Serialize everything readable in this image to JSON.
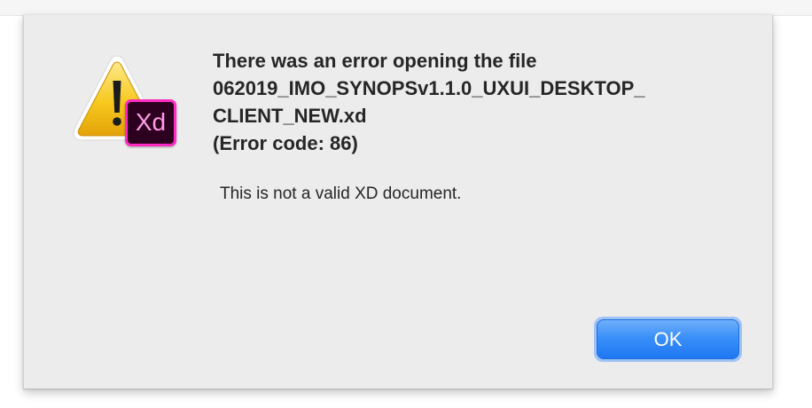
{
  "dialog": {
    "title_lines": [
      "There was an error opening the file",
      "062019_IMO_SYNOPSv1.1.0_UXUI_DESKTOP_",
      "CLIENT_NEW.xd",
      "(Error code: 86)"
    ],
    "message": "This is not a valid XD document.",
    "ok_label": "OK"
  },
  "icons": {
    "warning": "warning-triangle-icon",
    "app_badge": "xd-app-icon",
    "app_badge_text": "Xd"
  },
  "colors": {
    "dialog_background": "#ececec",
    "button_accent": "#2a84f6",
    "badge_border": "#ff2bc2",
    "badge_background": "#2e001f",
    "badge_text": "#ff9ce6",
    "warning_yellow": "#f7c81e"
  }
}
